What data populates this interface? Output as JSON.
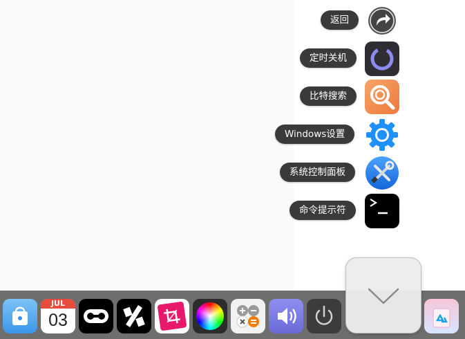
{
  "menu": {
    "items": [
      {
        "label": "返回",
        "icon": "share-arrow-icon"
      },
      {
        "label": "定时关机",
        "icon": "timer-shutdown-icon"
      },
      {
        "label": "比特搜索",
        "icon": "search-magnifier-icon"
      },
      {
        "label": "Windows设置",
        "icon": "gear-icon"
      },
      {
        "label": "系统控制面板",
        "icon": "tools-icon"
      },
      {
        "label": "命令提示符",
        "icon": "terminal-icon"
      }
    ]
  },
  "dock": {
    "calendar": {
      "month": "JUL",
      "day": "03"
    },
    "items": [
      "store-bag-icon",
      "calendar-icon",
      "voicemail-icon",
      "percent-icon",
      "crop-icon",
      "color-wheel-icon",
      "calculator-icon",
      "speaker-icon",
      "power-icon",
      "recycle-bin-icon"
    ]
  },
  "colors": {
    "pill_bg": "#3a3a3a",
    "dock_bg": "#6e6e6e",
    "gear_blue": "#1e90ff",
    "search_orange": "#f0884a"
  }
}
